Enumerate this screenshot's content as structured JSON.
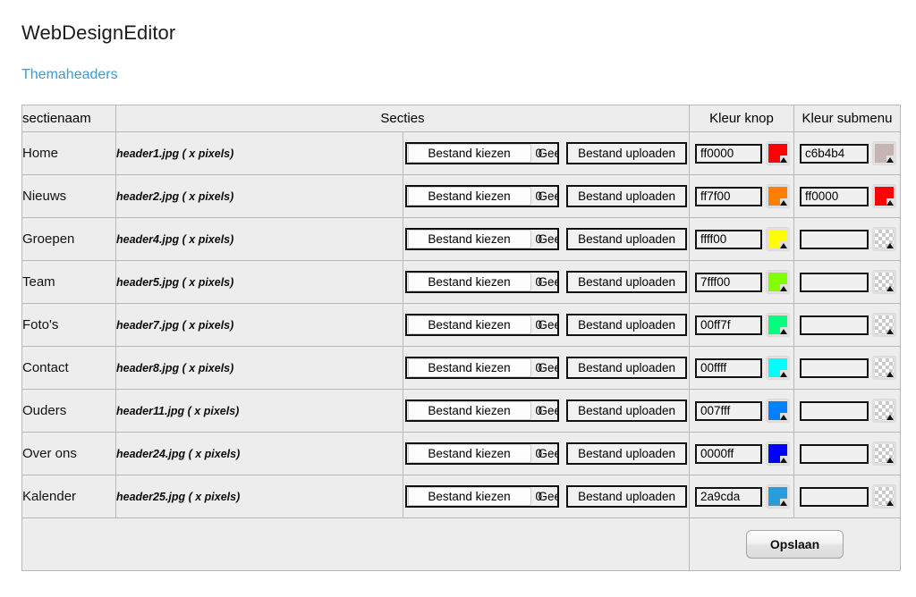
{
  "app": {
    "title": "WebDesignEditor",
    "section_link": "Themaheaders"
  },
  "table": {
    "headers": {
      "sectienaam": "sectienaam",
      "secties": "Secties",
      "kleur_knop": "Kleur knop",
      "kleur_submenu": "Kleur submenu"
    },
    "controls": {
      "choose_file": "Bestand kiezen",
      "no_file_chosen": "Geen bestand gekozen",
      "no_file_ghost": "0",
      "upload": "Bestand uploaden"
    },
    "rows": [
      {
        "name": "Home",
        "file": "header1.jpg ( x pixels)",
        "button_color_value": "ff0000",
        "button_color_hex": "#ff0000",
        "submenu_color_value": "c6b4b4",
        "submenu_color_hex": "#c6b4b4"
      },
      {
        "name": "Nieuws",
        "file": "header2.jpg ( x pixels)",
        "button_color_value": "ff7f00",
        "button_color_hex": "#ff7f00",
        "submenu_color_value": "ff0000",
        "submenu_color_hex": "#ff0000"
      },
      {
        "name": "Groepen",
        "file": "header4.jpg ( x pixels)",
        "button_color_value": "ffff00",
        "button_color_hex": "#ffff00",
        "submenu_color_value": "",
        "submenu_color_hex": ""
      },
      {
        "name": "Team",
        "file": "header5.jpg ( x pixels)",
        "button_color_value": "7fff00",
        "button_color_hex": "#7fff00",
        "submenu_color_value": "",
        "submenu_color_hex": ""
      },
      {
        "name": "Foto's",
        "file": "header7.jpg ( x pixels)",
        "button_color_value": "00ff7f",
        "button_color_hex": "#00ff7f",
        "submenu_color_value": "",
        "submenu_color_hex": ""
      },
      {
        "name": "Contact",
        "file": "header8.jpg ( x pixels)",
        "button_color_value": "00ffff",
        "button_color_hex": "#00ffff",
        "submenu_color_value": "",
        "submenu_color_hex": ""
      },
      {
        "name": "Ouders",
        "file": "header11.jpg ( x pixels)",
        "button_color_value": "007fff",
        "button_color_hex": "#007fff",
        "submenu_color_value": "",
        "submenu_color_hex": ""
      },
      {
        "name": "Over ons",
        "file": "header24.jpg ( x pixels)",
        "button_color_value": "0000ff",
        "button_color_hex": "#0000ff",
        "submenu_color_value": "",
        "submenu_color_hex": ""
      },
      {
        "name": "Kalender",
        "file": "header25.jpg ( x pixels)",
        "button_color_value": "2a9cda",
        "button_color_hex": "#2a9cda",
        "submenu_color_value": "",
        "submenu_color_hex": ""
      }
    ],
    "footer": {
      "save_label": "Opslaan"
    }
  },
  "theme": {
    "link_color": "#3e9bd4",
    "table_bg": "#ededed",
    "border_color": "#b9b9b9"
  }
}
